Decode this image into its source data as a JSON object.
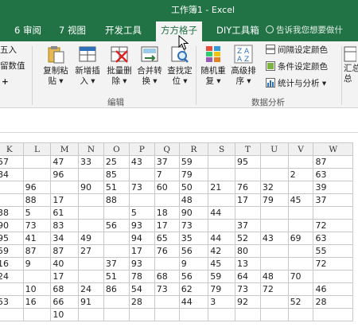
{
  "window": {
    "title": "工作簿1 - Excel"
  },
  "tabs": [
    {
      "label": "6 审阅",
      "active": false
    },
    {
      "label": "7 视图",
      "active": false
    },
    {
      "label": "开发工具",
      "active": false
    },
    {
      "label": "方方格子",
      "active": true
    },
    {
      "label": "DIY工具箱",
      "active": false
    }
  ],
  "tell_me": "告诉我您想要做什",
  "ribbon": {
    "left_partial": {
      "line1": "五入",
      "line2": "留数值",
      "line3": "+"
    },
    "edit_group": {
      "label": "编辑",
      "buttons": [
        {
          "line1": "复制粘",
          "line2": "贴 ▾"
        },
        {
          "line1": "新增插",
          "line2": "入 ▾"
        },
        {
          "line1": "批量删",
          "line2": "除 ▾"
        },
        {
          "line1": "合并转",
          "line2": "换 ▾"
        },
        {
          "line1": "查找定",
          "line2": "位 ▾"
        }
      ]
    },
    "analysis_group": {
      "label": "数据分析",
      "buttons": [
        {
          "line1": "随机重",
          "line2": "复 ▾"
        },
        {
          "line1": "高级排",
          "line2": "序 ▾"
        }
      ],
      "small_buttons": [
        {
          "label": "间隔设定颜色"
        },
        {
          "label": "条件设定颜色"
        },
        {
          "label": "统计与分析 ▾"
        }
      ]
    },
    "right_partial": {
      "line1": "汇总",
      "line2": "总"
    }
  },
  "grid": {
    "columns": [
      "K",
      "L",
      "M",
      "N",
      "O",
      "P",
      "Q",
      "R",
      "S",
      "T",
      "U",
      "V",
      "W"
    ],
    "rows": [
      [
        "57",
        "",
        "47",
        "33",
        "25",
        "43",
        "37",
        "59",
        "",
        "95",
        "",
        "",
        "87"
      ],
      [
        "84",
        "",
        "96",
        "",
        "85",
        "",
        "7",
        "79",
        "",
        "",
        "",
        "2",
        "63"
      ],
      [
        "",
        "96",
        "",
        "90",
        "51",
        "73",
        "60",
        "50",
        "21",
        "76",
        "32",
        "",
        "39"
      ],
      [
        "",
        "88",
        "17",
        "",
        "88",
        "",
        "",
        "48",
        "",
        "17",
        "79",
        "45",
        "37"
      ],
      [
        "38",
        "5",
        "61",
        "",
        "",
        "5",
        "18",
        "90",
        "44",
        "",
        "",
        "",
        ""
      ],
      [
        "90",
        "73",
        "83",
        "",
        "56",
        "93",
        "17",
        "73",
        "",
        "37",
        "",
        "",
        "72"
      ],
      [
        "95",
        "41",
        "34",
        "49",
        "",
        "94",
        "65",
        "35",
        "44",
        "52",
        "43",
        "69",
        "63"
      ],
      [
        "59",
        "87",
        "87",
        "27",
        "",
        "17",
        "76",
        "56",
        "42",
        "80",
        "",
        "",
        "55"
      ],
      [
        "16",
        "9",
        "40",
        "",
        "37",
        "93",
        "",
        "9",
        "45",
        "13",
        "",
        "",
        "72"
      ],
      [
        "24",
        "",
        "17",
        "",
        "51",
        "78",
        "68",
        "56",
        "59",
        "64",
        "48",
        "70",
        ""
      ],
      [
        "",
        "10",
        "68",
        "24",
        "86",
        "54",
        "73",
        "62",
        "79",
        "73",
        "72",
        "",
        "46"
      ],
      [
        "53",
        "16",
        "66",
        "91",
        "",
        "28",
        "",
        "44",
        "3",
        "92",
        "",
        "52",
        "28"
      ],
      [
        "",
        "",
        "10",
        "",
        "",
        "",
        "",
        "",
        "",
        "",
        "",
        "",
        ""
      ]
    ]
  },
  "colors": {
    "accent": "#217346",
    "ribbon_bg": "#f3f3f3"
  }
}
